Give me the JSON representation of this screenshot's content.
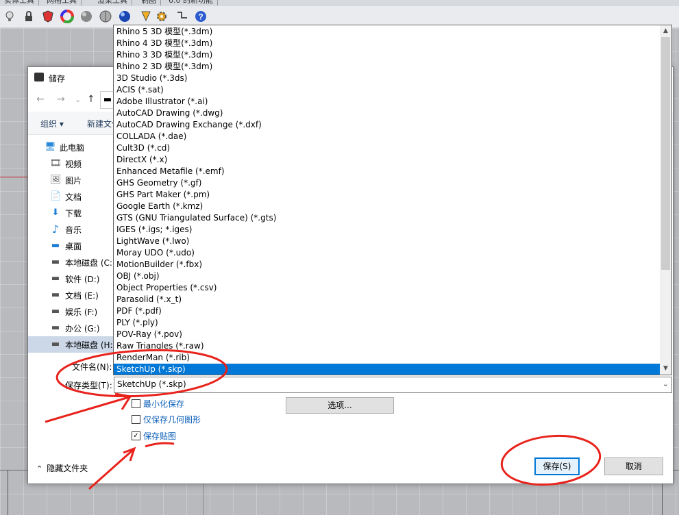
{
  "rhino": {
    "tabs": [
      "实体工具",
      "网格工具",
      "渲染工具",
      "制图",
      "6.0 的新功能"
    ],
    "toolbar_icons": [
      "lightbulb-icon",
      "lock-icon",
      "shield-icon",
      "color-wheel-icon",
      "gray-sphere-icon",
      "silver-sphere-icon",
      "blue-sphere-icon",
      "render-cone-icon",
      "gear-icon",
      "dimension-icon",
      "help-icon"
    ]
  },
  "dialog": {
    "title": "储存",
    "nav": {
      "back": "←",
      "forward": "→",
      "dropdown": "⌄",
      "up": "↑",
      "address": "▬"
    },
    "commands": {
      "organize": "组织 ▾",
      "new_folder": "新建文件夹"
    },
    "sidebar": [
      {
        "label": "此电脑",
        "icon": "computer-icon",
        "glyph": "🖥"
      },
      {
        "label": "视频",
        "icon": "video-icon",
        "glyph": "🎞"
      },
      {
        "label": "图片",
        "icon": "picture-icon",
        "glyph": "🖼"
      },
      {
        "label": "文档",
        "icon": "document-icon",
        "glyph": "📄"
      },
      {
        "label": "下载",
        "icon": "download-icon",
        "glyph": "⬇"
      },
      {
        "label": "音乐",
        "icon": "music-icon",
        "glyph": "♪"
      },
      {
        "label": "桌面",
        "icon": "desktop-icon",
        "glyph": "▬"
      },
      {
        "label": "本地磁盘 (C:)",
        "icon": "drive-icon",
        "glyph": "▬"
      },
      {
        "label": "软件 (D:)",
        "icon": "drive-icon",
        "glyph": "▬"
      },
      {
        "label": "文档 (E:)",
        "icon": "drive-icon",
        "glyph": "▬"
      },
      {
        "label": "娱乐 (F:)",
        "icon": "drive-icon",
        "glyph": "▬"
      },
      {
        "label": "办公 (G:)",
        "icon": "drive-icon",
        "glyph": "▬"
      },
      {
        "label": "本地磁盘 (H:)",
        "icon": "drive-icon",
        "glyph": "▬",
        "selected": true
      }
    ],
    "file_name_label": "文件名(N):",
    "file_type_label": "保存类型(T):",
    "file_type_value": "SketchUp (*.skp)",
    "file_type_arrow": "⌄",
    "file_types": [
      "Rhino 5 3D 模型(*.3dm)",
      "Rhino 4 3D 模型(*.3dm)",
      "Rhino 3 3D 模型(*.3dm)",
      "Rhino 2 3D 模型(*.3dm)",
      "3D Studio (*.3ds)",
      "ACIS (*.sat)",
      "Adobe Illustrator (*.ai)",
      "AutoCAD Drawing (*.dwg)",
      "AutoCAD Drawing Exchange (*.dxf)",
      "COLLADA (*.dae)",
      "Cult3D (*.cd)",
      "DirectX (*.x)",
      "Enhanced Metafile (*.emf)",
      "GHS Geometry (*.gf)",
      "GHS Part Maker (*.pm)",
      "Google Earth (*.kmz)",
      "GTS (GNU Triangulated Surface) (*.gts)",
      "IGES (*.igs; *.iges)",
      "LightWave (*.lwo)",
      "Moray UDO (*.udo)",
      "MotionBuilder (*.fbx)",
      "OBJ (*.obj)",
      "Object Properties (*.csv)",
      "Parasolid (*.x_t)",
      "PDF (*.pdf)",
      "PLY (*.ply)",
      "POV-Ray (*.pov)",
      "Raw Triangles (*.raw)",
      "RenderMan (*.rib)",
      "SketchUp (*.skp)"
    ],
    "selected_type_index": 29,
    "scroll_up": "▲",
    "scroll_down": "▼",
    "checkboxes": [
      {
        "label": "最小化保存",
        "checked": false
      },
      {
        "label": "仅保存几何图形",
        "checked": false
      },
      {
        "label": "保存贴图",
        "checked": true
      }
    ],
    "check_mark": "✓",
    "options_button": "选项...",
    "hide_folders": {
      "chevron": "⌃",
      "label": "隐藏文件夹"
    },
    "save_button": "保存(S)",
    "cancel_button": "取消"
  },
  "annotations": {
    "color": "#e8231c"
  }
}
